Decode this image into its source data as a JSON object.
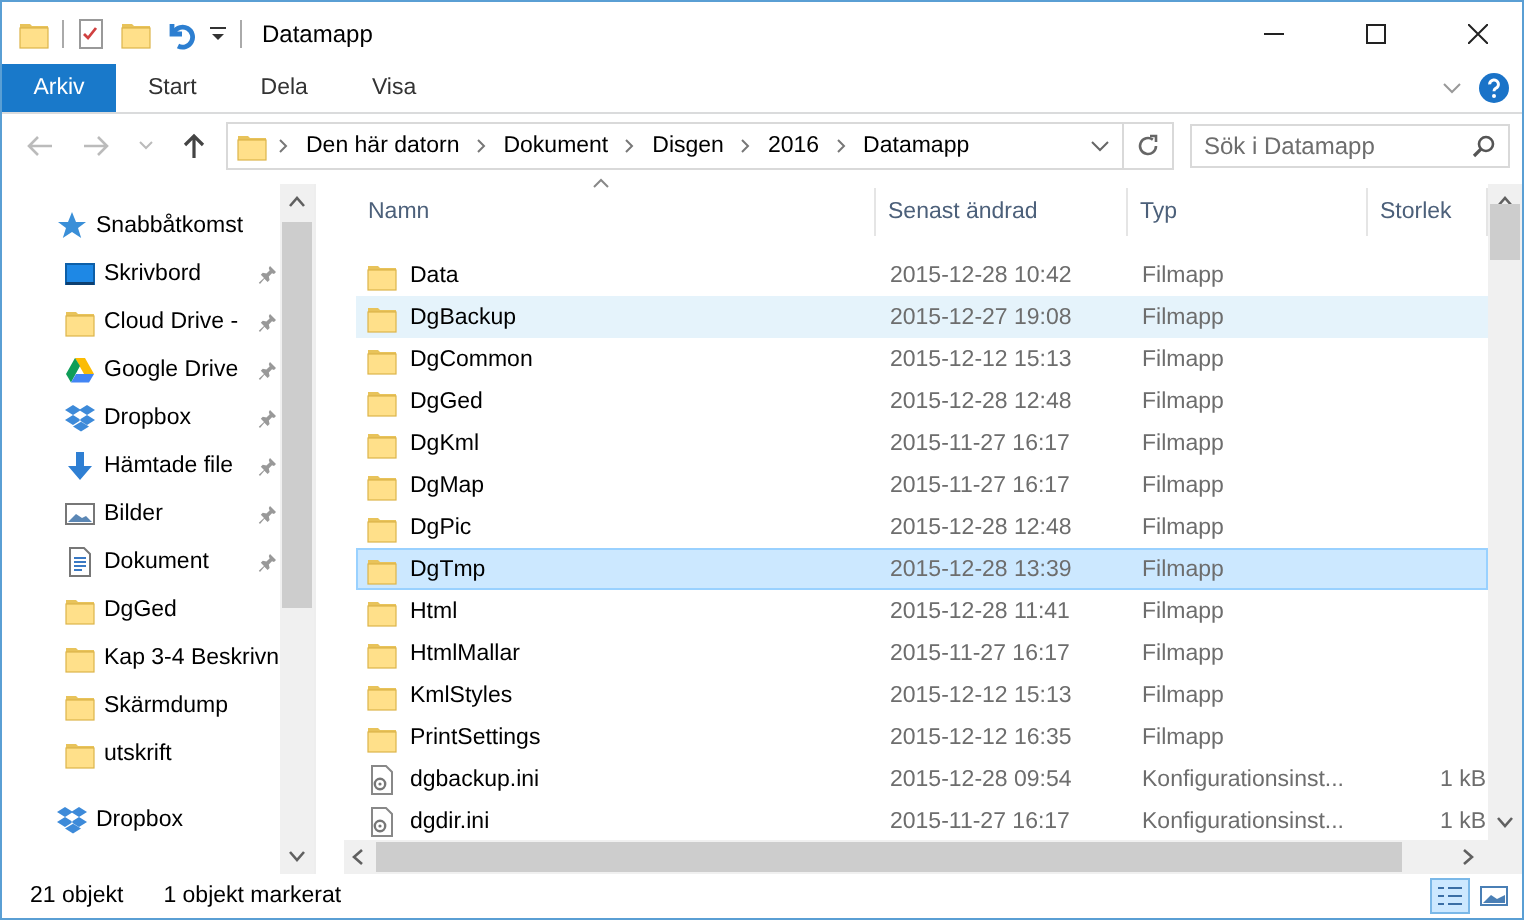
{
  "window": {
    "title": "Datamapp"
  },
  "ribbon": {
    "tabs": [
      {
        "label": "Arkiv",
        "selected": true
      },
      {
        "label": "Start",
        "selected": false
      },
      {
        "label": "Dela",
        "selected": false
      },
      {
        "label": "Visa",
        "selected": false
      }
    ]
  },
  "address": {
    "crumbs": [
      "Den här datorn",
      "Dokument",
      "Disgen",
      "2016",
      "Datamapp"
    ],
    "search": {
      "placeholder": "Sök i Datamapp"
    }
  },
  "sidebar": {
    "items": [
      {
        "label": "Snabbåtkomst",
        "kind": "star",
        "pinned": false,
        "top": true
      },
      {
        "label": "Skrivbord",
        "kind": "desktop",
        "pinned": true,
        "top": false
      },
      {
        "label": "Cloud Drive -",
        "kind": "folder",
        "pinned": true,
        "top": false
      },
      {
        "label": "Google Drive",
        "kind": "gdrive",
        "pinned": true,
        "top": false
      },
      {
        "label": "Dropbox",
        "kind": "dropbox",
        "pinned": true,
        "top": false
      },
      {
        "label": "Hämtade file",
        "kind": "download",
        "pinned": true,
        "top": false
      },
      {
        "label": "Bilder",
        "kind": "picture",
        "pinned": true,
        "top": false
      },
      {
        "label": "Dokument",
        "kind": "document",
        "pinned": true,
        "top": false
      },
      {
        "label": "DgGed",
        "kind": "folder",
        "pinned": false,
        "top": false
      },
      {
        "label": "Kap 3-4 Beskrivn",
        "kind": "folder",
        "pinned": false,
        "top": false
      },
      {
        "label": "Skärmdump",
        "kind": "folder",
        "pinned": false,
        "top": false
      },
      {
        "label": "utskrift",
        "kind": "folder",
        "pinned": false,
        "top": false
      },
      {
        "label": "Dropbox",
        "kind": "dropbox",
        "pinned": false,
        "top": true
      }
    ]
  },
  "table": {
    "columns": [
      "Namn",
      "Senast ändrad",
      "Typ",
      "Storlek"
    ],
    "rows": [
      {
        "kind": "folder",
        "name": "Data",
        "modified": "2015-12-28 10:42",
        "type": "Filmapp",
        "selected": false,
        "hovered": false
      },
      {
        "kind": "folder",
        "name": "DgBackup",
        "modified": "2015-12-27 19:08",
        "type": "Filmapp",
        "selected": false,
        "hovered": true
      },
      {
        "kind": "folder",
        "name": "DgCommon",
        "modified": "2015-12-12 15:13",
        "type": "Filmapp",
        "selected": false,
        "hovered": false
      },
      {
        "kind": "folder",
        "name": "DgGed",
        "modified": "2015-12-28 12:48",
        "type": "Filmapp",
        "selected": false,
        "hovered": false
      },
      {
        "kind": "folder",
        "name": "DgKml",
        "modified": "2015-11-27 16:17",
        "type": "Filmapp",
        "selected": false,
        "hovered": false
      },
      {
        "kind": "folder",
        "name": "DgMap",
        "modified": "2015-11-27 16:17",
        "type": "Filmapp",
        "selected": false,
        "hovered": false
      },
      {
        "kind": "folder",
        "name": "DgPic",
        "modified": "2015-12-28 12:48",
        "type": "Filmapp",
        "selected": false,
        "hovered": false
      },
      {
        "kind": "folder",
        "name": "DgTmp",
        "modified": "2015-12-28 13:39",
        "type": "Filmapp",
        "selected": true,
        "hovered": false
      },
      {
        "kind": "folder",
        "name": "Html",
        "modified": "2015-12-28 11:41",
        "type": "Filmapp",
        "selected": false,
        "hovered": false
      },
      {
        "kind": "folder",
        "name": "HtmlMallar",
        "modified": "2015-11-27 16:17",
        "type": "Filmapp",
        "selected": false,
        "hovered": false
      },
      {
        "kind": "folder",
        "name": "KmlStyles",
        "modified": "2015-12-12 15:13",
        "type": "Filmapp",
        "selected": false,
        "hovered": false
      },
      {
        "kind": "folder",
        "name": "PrintSettings",
        "modified": "2015-12-12 16:35",
        "type": "Filmapp",
        "selected": false,
        "hovered": false
      },
      {
        "kind": "ini",
        "name": "dgbackup.ini",
        "modified": "2015-12-28 09:54",
        "type": "Konfigurationsinst...",
        "size": "1 kB",
        "selected": false,
        "hovered": false
      },
      {
        "kind": "ini",
        "name": "dgdir.ini",
        "modified": "2015-11-27 16:17",
        "type": "Konfigurationsinst...",
        "size": "1 kB",
        "selected": false,
        "hovered": false
      }
    ]
  },
  "status_bar": {
    "count": "21 objekt",
    "selection": "1 objekt markerat"
  }
}
